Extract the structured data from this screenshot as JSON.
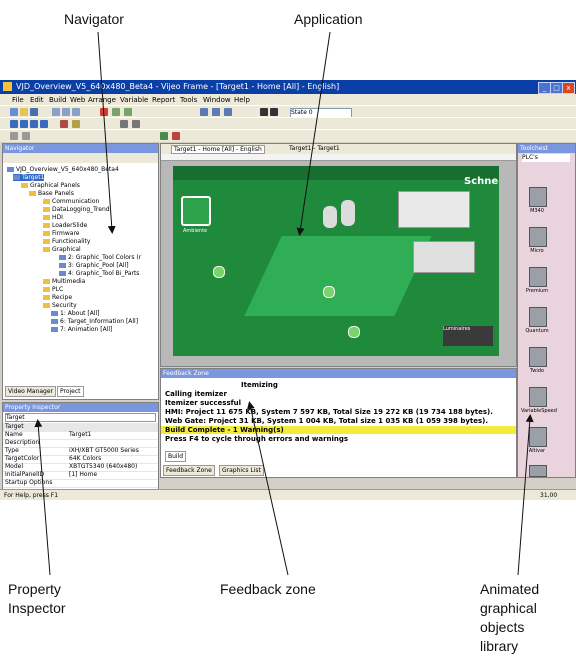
{
  "callouts": {
    "navigator": "Navigator",
    "application": "Application",
    "property_inspector": "Property\nInspector",
    "feedback_zone": "Feedback zone",
    "library": "Animated\ngraphical\nobjects\nlibrary"
  },
  "window": {
    "title": "VJD_Overview_V5_640x480_Beta4 - Vijeo Frame - [Target1 - Home [All] - English]",
    "minimize": "_",
    "maximize": "□",
    "close": "x"
  },
  "menu": [
    "File",
    "Edit",
    "Build",
    "Web",
    "Arrange",
    "Variable",
    "Report",
    "Tools",
    "Window",
    "Help"
  ],
  "toolbar": {
    "state_label": "State 0"
  },
  "navigator": {
    "header": "Navigator",
    "project": "VJD_Overview_V5_640x480_Beta4",
    "items": [
      "Target1",
      "Graphical Panels",
      "Base Panels",
      "Communication",
      "DataLogging_Trend",
      "HDI",
      "LoaderSlide",
      "Firmware",
      "Functionality",
      "Graphical",
      "2: Graphic_Tool Colors (r",
      "3: Graphic_Pool [All]",
      "4: Graphic_Tool Bi_Parts",
      "Multimedia",
      "PLC",
      "Recipe",
      "Security",
      "1: About [All]",
      "6: Target_Information [All]",
      "7: Animation [All]"
    ],
    "tab_manager": "Video Manager",
    "tab_project": "Project"
  },
  "property_inspector": {
    "header": "Property Inspector",
    "object": "Target",
    "rows": [
      {
        "k": "Target",
        "v": ""
      },
      {
        "k": "Name",
        "v": "Target1"
      },
      {
        "k": "Description",
        "v": ""
      },
      {
        "k": "Type",
        "v": "iXH/XBT GT5000 Series"
      },
      {
        "k": "TargetColor",
        "v": "64K Colors"
      },
      {
        "k": "Model",
        "v": "XBTGT5340 (640x480)"
      },
      {
        "k": "InitialPanelID",
        "v": "[1] Home"
      },
      {
        "k": "Startup Options",
        "v": ""
      }
    ]
  },
  "status": {
    "help": "For Help, press F1",
    "pos": "31,00"
  },
  "app_tabs": [
    "Target1 - Home [All] - English",
    "Target1 - Target1"
  ],
  "app": {
    "logo": "Schne",
    "icon_label": "Ambiente",
    "side_label": "Luminaires"
  },
  "feedback": {
    "header": "Feedback Zone",
    "lines": [
      "Itemizing",
      "Calling itemizer",
      "Itemizer successful",
      "HMI: Project 11  675 KB, System 7  597 KB, Total Size 19  272 KB (19  734  188 bytes).",
      "Web Gate: Project 31 KB, System 1  004 KB, Total size 1  035 KB (1  059  398 bytes).",
      "Build Complete - 1 Warning(s)",
      "Press F4 to cycle through errors and warnings"
    ],
    "tab_build": "Build",
    "tab_feedback": "Feedback Zone",
    "tab_graphics": "Graphics List"
  },
  "toolchest": {
    "header": "Toolchest",
    "title": "PLC's",
    "items": [
      "M340",
      "Micro",
      "Premium",
      "Quantum",
      "Twido",
      "VariableSpeed",
      "Altivar",
      ""
    ]
  }
}
